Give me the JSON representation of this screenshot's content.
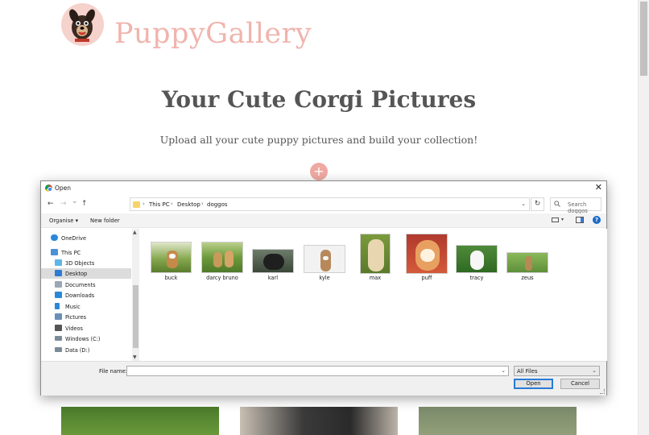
{
  "page": {
    "brand": "PuppyGallery",
    "title": "Your Cute Corgi Pictures",
    "subtitle": "Upload all your cute puppy pictures and build your collection!",
    "add_button": "+"
  },
  "dialog": {
    "title": "Open",
    "close_glyph": "✕",
    "nav": {
      "back": "←",
      "forward": "→",
      "recent": "⌄",
      "up": "↑"
    },
    "breadcrumb": [
      "This PC",
      "Desktop",
      "doggos"
    ],
    "breadcrumb_sep": "›",
    "refresh_glyph": "↻",
    "search_placeholder": "Search doggos",
    "toolbar": {
      "organise": "Organise ▾",
      "new_folder": "New folder",
      "view_dd": "▾",
      "help": "?"
    },
    "sidebar": [
      {
        "label": "OneDrive",
        "icon": "cloud-icon",
        "color": "#2b88d8"
      },
      {
        "label": "This PC",
        "icon": "computer-icon",
        "color": "#4a90d9"
      },
      {
        "label": "3D Objects",
        "icon": "cube-icon",
        "color": "#5fb6e8"
      },
      {
        "label": "Desktop",
        "icon": "desktop-icon",
        "color": "#2d7cd3",
        "selected": true
      },
      {
        "label": "Documents",
        "icon": "document-icon",
        "color": "#9aa7b5"
      },
      {
        "label": "Downloads",
        "icon": "download-icon",
        "color": "#2b88d8"
      },
      {
        "label": "Music",
        "icon": "music-icon",
        "color": "#2b88d8"
      },
      {
        "label": "Pictures",
        "icon": "pictures-icon",
        "color": "#6a8fb7"
      },
      {
        "label": "Videos",
        "icon": "video-icon",
        "color": "#555555"
      },
      {
        "label": "Windows (C:)",
        "icon": "drive-icon",
        "color": "#7a8a99"
      },
      {
        "label": "Data (D:)",
        "icon": "drive-icon",
        "color": "#7a8a99"
      }
    ],
    "files": [
      {
        "name": "buck",
        "colors": [
          "#4d7a2c",
          "#c58a4a"
        ]
      },
      {
        "name": "darcy bruno",
        "colors": [
          "#5d8a3a",
          "#c89a5a"
        ]
      },
      {
        "name": "karl",
        "colors": [
          "#3d4a3a",
          "#2a2a2a"
        ]
      },
      {
        "name": "kyle",
        "colors": [
          "#f4f4f4",
          "#b7895a"
        ]
      },
      {
        "name": "max",
        "colors": [
          "#6a8a3a",
          "#e8d6b0"
        ]
      },
      {
        "name": "puff",
        "colors": [
          "#c04a3a",
          "#e8a060"
        ]
      },
      {
        "name": "tracy",
        "colors": [
          "#3f7a2f",
          "#f4f4f4"
        ]
      },
      {
        "name": "zeus",
        "colors": [
          "#6a9a4a",
          "#b58a55"
        ]
      }
    ],
    "file_name_label": "File name:",
    "file_name_value": "",
    "filter_value": "All Files",
    "open_button": "Open",
    "cancel_button": "Cancel",
    "dropdown_glyph": "⌄"
  }
}
